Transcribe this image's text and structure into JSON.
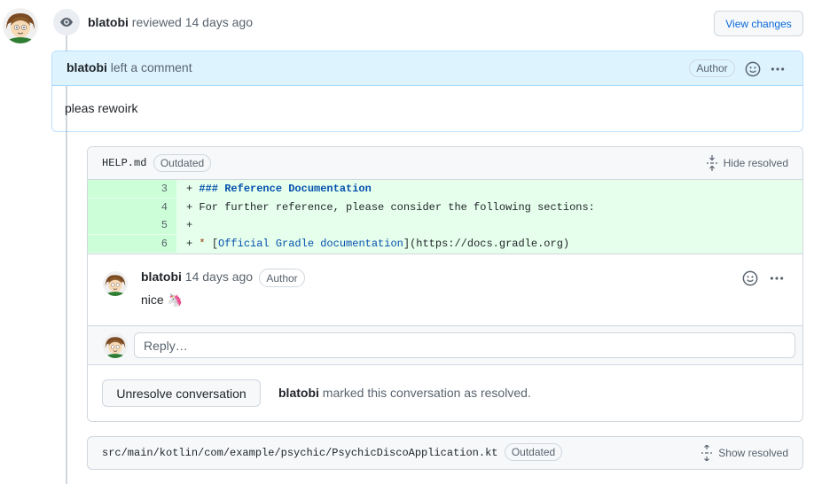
{
  "review": {
    "user": "blatobi",
    "action": "reviewed",
    "time": "14 days ago",
    "view_changes_label": "View changes"
  },
  "main_comment": {
    "user": "blatobi",
    "action": "left a comment",
    "badge": "Author",
    "body": "pleas rewoirk"
  },
  "thread": {
    "file": "HELP.md",
    "status_badge": "Outdated",
    "hide_resolved_label": "Hide resolved",
    "diff_lines": [
      {
        "num": "3",
        "prefix": "+ ",
        "heading": "### Reference Documentation"
      },
      {
        "num": "4",
        "prefix": "+ ",
        "text": "For further reference, please consider the following sections:"
      },
      {
        "num": "5",
        "prefix": "+",
        "text": ""
      },
      {
        "num": "6",
        "prefix": "+ ",
        "bullet": "* ",
        "link_open": "[",
        "link_text": "Official Gradle documentation",
        "link_close": "]",
        "url": "(https://docs.gradle.org)"
      }
    ],
    "comment": {
      "user": "blatobi",
      "time": "14 days ago",
      "badge": "Author",
      "body": "nice 🦄"
    },
    "reply_placeholder": "Reply…",
    "unresolve_label": "Unresolve conversation",
    "resolved_user": "blatobi",
    "resolved_text": "marked this conversation as resolved."
  },
  "second_file": {
    "path": "src/main/kotlin/com/example/psychic/PsychicDiscoApplication.kt",
    "status_badge": "Outdated",
    "show_resolved_label": "Show resolved"
  },
  "colors": {
    "accent": "#0969da",
    "diff_add_bg": "#e6ffec",
    "diff_num_bg": "#ccffd8",
    "comment_header_bg": "#ddf4ff"
  }
}
